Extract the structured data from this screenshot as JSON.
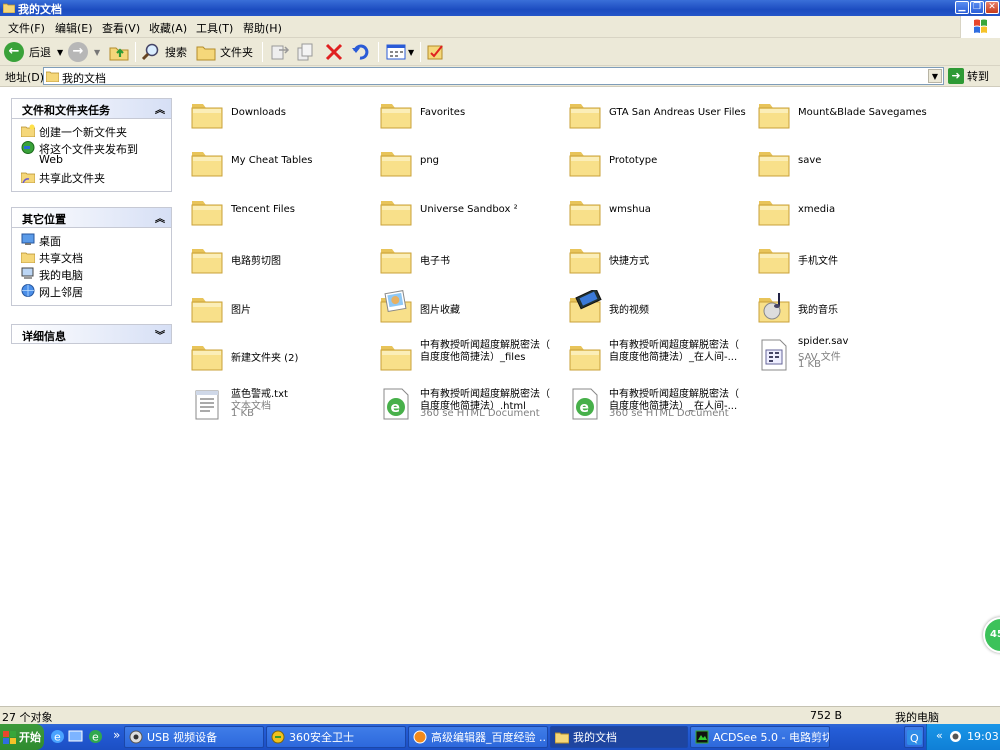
{
  "window": {
    "title": "我的文档"
  },
  "menu": {
    "items": [
      "文件(F)",
      "编辑(E)",
      "查看(V)",
      "收藏(A)",
      "工具(T)",
      "帮助(H)"
    ]
  },
  "toolbar": {
    "back_label": "后退",
    "search_label": "搜索",
    "folders_label": "文件夹"
  },
  "address": {
    "label": "地址(D)",
    "value": "我的文档",
    "go_label": "转到"
  },
  "left_panel": {
    "tasks": {
      "title": "文件和文件夹任务",
      "items": [
        "创建一个新文件夹",
        "将这个文件夹发布到",
        "Web",
        "共享此文件夹"
      ]
    },
    "places": {
      "title": "其它位置",
      "items": [
        "桌面",
        "共享文档",
        "我的电脑",
        "网上邻居"
      ]
    },
    "details": {
      "title": "详细信息"
    }
  },
  "files": [
    {
      "name": "Downloads",
      "icon": "folder-icon"
    },
    {
      "name": "Favorites",
      "icon": "folder-icon"
    },
    {
      "name": "GTA San Andreas User Files",
      "icon": "folder-icon"
    },
    {
      "name": "Mount&Blade Savegames",
      "icon": "folder-icon"
    },
    {
      "name": "My Cheat Tables",
      "icon": "folder-icon"
    },
    {
      "name": "png",
      "icon": "folder-icon"
    },
    {
      "name": "Prototype",
      "icon": "folder-icon"
    },
    {
      "name": "save",
      "icon": "folder-icon"
    },
    {
      "name": "Tencent Files",
      "icon": "folder-icon"
    },
    {
      "name": "Universe Sandbox ²",
      "icon": "folder-icon"
    },
    {
      "name": "wmshua",
      "icon": "folder-icon"
    },
    {
      "name": "xmedia",
      "icon": "folder-icon"
    },
    {
      "name": "电路剪切图",
      "icon": "folder-icon"
    },
    {
      "name": "电子书",
      "icon": "folder-icon"
    },
    {
      "name": "快捷方式",
      "icon": "folder-icon"
    },
    {
      "name": "手机文件",
      "icon": "folder-icon"
    },
    {
      "name": "图片",
      "icon": "folder-icon"
    },
    {
      "name": "图片收藏",
      "icon": "picture-folder-icon"
    },
    {
      "name": "我的视频",
      "icon": "video-folder-icon"
    },
    {
      "name": "我的音乐",
      "icon": "music-folder-icon"
    },
    {
      "name": "新建文件夹 (2)",
      "icon": "folder-icon"
    },
    {
      "name": "中有教授听闻超度解脱密法（",
      "line2": "自度度他简捷法）_files",
      "icon": "folder-icon"
    },
    {
      "name": "中有教授听闻超度解脱密法（",
      "line2": "自度度他简捷法）_在人间-...",
      "icon": "folder-icon"
    },
    {
      "name": "spider.sav",
      "type": "SAV 文件",
      "size": "1 KB",
      "icon": "sav-file-icon"
    },
    {
      "name": "蓝色警戒.txt",
      "type": "文本文档",
      "size": "1 KB",
      "icon": "text-file-icon"
    },
    {
      "name": "中有教授听闻超度解脱密法（",
      "line2": "自度度他简捷法）.html",
      "type": "360 se HTML Document",
      "icon": "html-file-icon"
    },
    {
      "name": "中有教授听闻超度解脱密法（",
      "line2": "自度度他简捷法）_在人间-...",
      "type": "360 se HTML Document",
      "icon": "html-file-icon"
    }
  ],
  "status": {
    "count": "27 个对象",
    "size": "752 B",
    "location": "我的电脑"
  },
  "taskbar": {
    "start": "开始",
    "tasks": [
      "USB 视频设备",
      "360安全卫士",
      "高级编辑器_百度经验 ...",
      "我的文档",
      "ACDSee 5.0 - 电路剪切图"
    ],
    "clock": "19:03"
  },
  "overlay": {
    "badge": "45"
  }
}
